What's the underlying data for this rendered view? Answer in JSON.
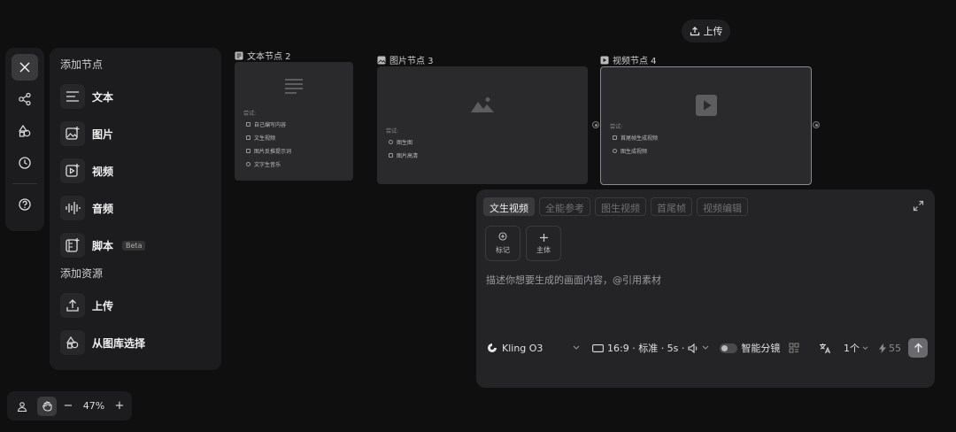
{
  "upload_pill": {
    "label": "上传"
  },
  "add_nodes": {
    "title": "添加节点",
    "items": [
      {
        "label": "文本",
        "icon": "text-lines-icon"
      },
      {
        "label": "图片",
        "icon": "image-add-icon"
      },
      {
        "label": "视频",
        "icon": "video-add-icon"
      },
      {
        "label": "音频",
        "icon": "audio-wave-icon"
      },
      {
        "label": "脚本",
        "icon": "script-icon",
        "badge": "Beta"
      }
    ]
  },
  "add_assets": {
    "title": "添加资源",
    "items": [
      {
        "label": "上传",
        "icon": "upload-icon"
      },
      {
        "label": "从图库选择",
        "icon": "gallery-icon"
      }
    ]
  },
  "zoom": {
    "level": "47%",
    "minus": "−",
    "plus": "+"
  },
  "nodes": {
    "text": {
      "label": "文本节点 2",
      "hint_title": "尝试:",
      "hints": [
        "自己编写内容",
        "文生视频",
        "图片反推提示词",
        "文字生音乐"
      ]
    },
    "image": {
      "label": "图片节点 3",
      "hint_title": "尝试:",
      "hints": [
        "图生图",
        "图片高清"
      ]
    },
    "video": {
      "label": "视频节点 4",
      "hint_title": "尝试:",
      "hints": [
        "首尾帧生成视频",
        "图生成视频"
      ]
    }
  },
  "prompt": {
    "tabs": [
      {
        "label": "文生视频",
        "active": true
      },
      {
        "label": "全能参考",
        "active": false
      },
      {
        "label": "图生视频",
        "active": false
      },
      {
        "label": "首尾帧",
        "active": false
      },
      {
        "label": "视频编辑",
        "active": false
      }
    ],
    "chips": [
      {
        "label": "标记"
      },
      {
        "label": "主体"
      }
    ],
    "placeholder": "描述你想要生成的画面内容，@引用素材",
    "model": "Kling O3",
    "settings": "16:9 · 标准 · 5s ·",
    "smart_storyboard": "智能分镜",
    "count": "1个",
    "credits": "55"
  },
  "colors": {
    "background": "#0f0f10",
    "panel": "#1c1c1e",
    "card": "#2a2a2c"
  }
}
